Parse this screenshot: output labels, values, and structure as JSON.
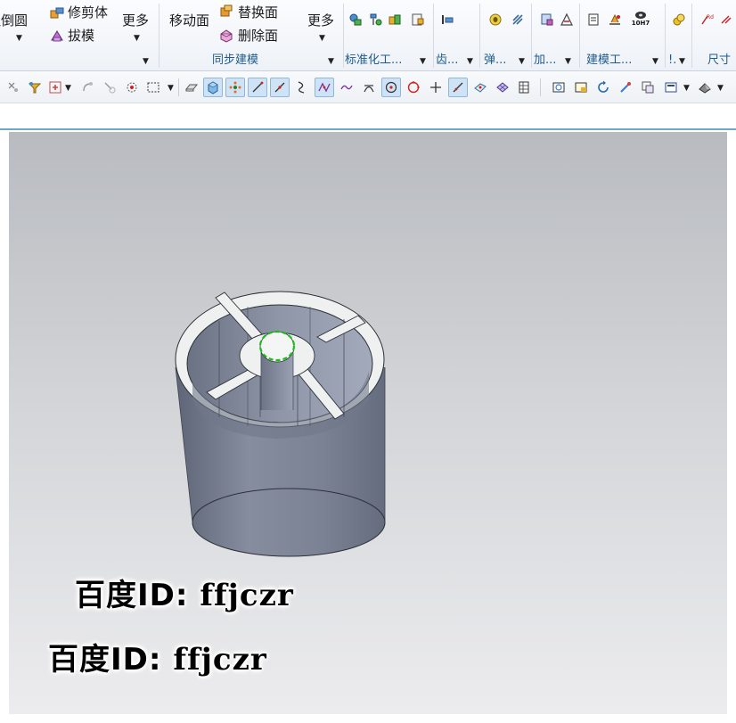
{
  "ribbon": {
    "feature_group": {
      "fillet_label": "边倒圆",
      "trim_body_label": "修剪体",
      "draft_label": "拔模",
      "more_label": "更多"
    },
    "sync_group": {
      "move_face_label": "移动面",
      "replace_face_label": "替换面",
      "delete_face_label": "删除面",
      "more_label": "更多",
      "group_label": "同步建模"
    },
    "groups": {
      "standardization": "标准化工...",
      "gear": "齿...",
      "spring": "弹...",
      "add": "加...",
      "modeling_tools": "建模工...",
      "dot": "!.",
      "dimension": "尺寸"
    },
    "tolerance_icon_text": "10H7"
  },
  "toolbar": {
    "icons": [
      "select-snap-icon",
      "filter-icon",
      "add-point-icon",
      "arc-snap-icon",
      "curve-snap-icon",
      "select-circle-icon",
      "select-rect-icon",
      "dropdown-caret-icon",
      "face-select-icon",
      "solid-body-icon",
      "vertex-snap-icon",
      "line-icon",
      "edge-icon",
      "spline-icon",
      "intersection-curve-icon",
      "wave-curve-icon",
      "tangent-icon",
      "center-point-icon",
      "quadrant-point-icon",
      "cross-point-icon",
      "on-curve-icon",
      "face-point-icon",
      "mesh-icon",
      "grid-icon",
      "view-fit-icon",
      "view-frame-icon",
      "rotate-icon",
      "pan-icon",
      "layer-icon",
      "display-mode-icon",
      "render-style-icon"
    ]
  },
  "watermark": {
    "line1": "百度ID: ffjczr",
    "line1_cjk": "百度ID:",
    "line1_latin": "ffjczr",
    "line2_cjk": "百度ID:",
    "line2_latin": "ffjczr"
  },
  "colors": {
    "ribbon_label": "#1f5b8c",
    "viewport_top": "#b8bbc0",
    "viewport_bottom": "#ececee",
    "model_body": "#7c8496",
    "model_rim": "#f4f6f5",
    "selection": "#16c016"
  }
}
